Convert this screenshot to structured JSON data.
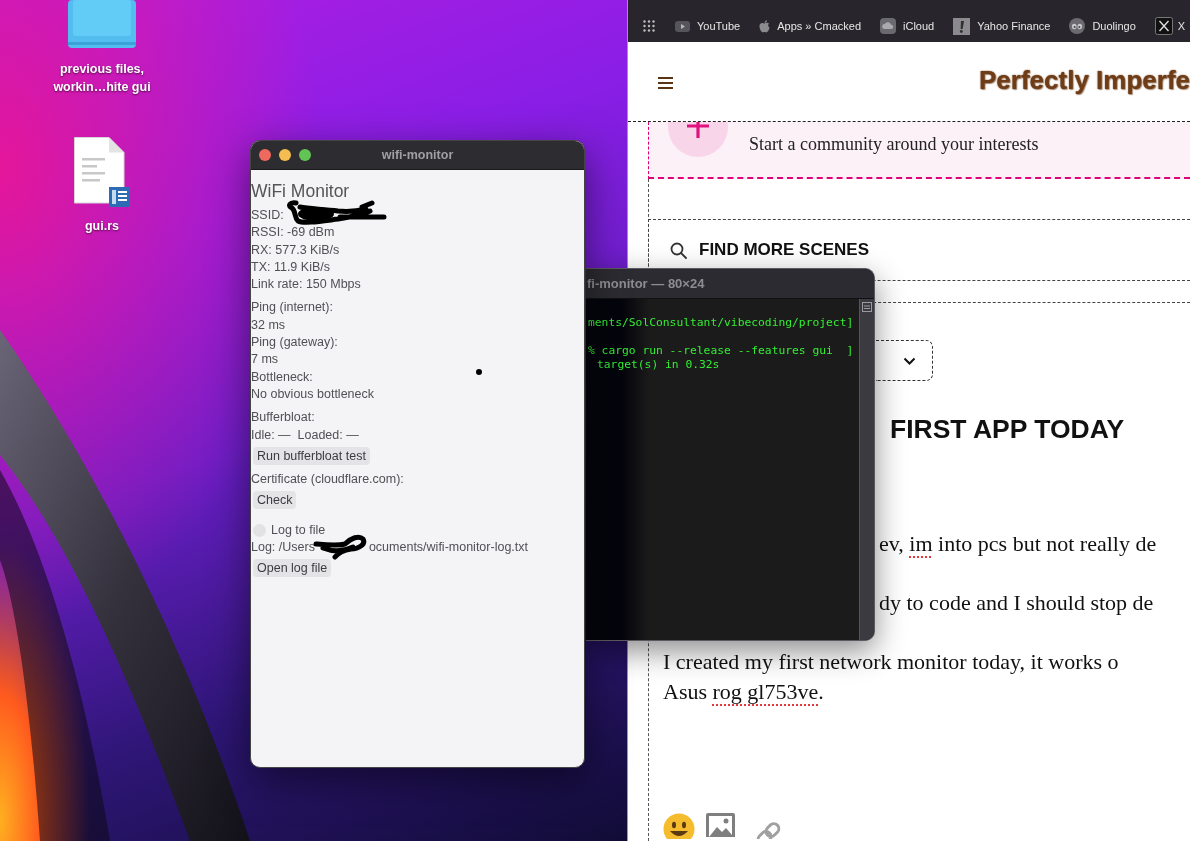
{
  "desktop": {
    "icons": [
      {
        "kind": "folder",
        "label": "previous files, workin…hite gui"
      },
      {
        "kind": "document",
        "label": "gui.rs"
      }
    ]
  },
  "browser": {
    "bookmarks": [
      {
        "label": "YouTube"
      },
      {
        "label": "Apps » Cmacked"
      },
      {
        "label": "iCloud"
      },
      {
        "label": "Yahoo Finance"
      },
      {
        "label": "Duolingo"
      },
      {
        "label": "X"
      }
    ],
    "logo": "Perfectly Imperfe",
    "banner": {
      "text": "Start a community around your interests"
    },
    "find_button": {
      "label": "FIND MORE SCENES"
    },
    "post": {
      "title": "FIRST APP TODAY",
      "paragraphs": [
        {
          "covered": true,
          "lines": [
            [
              {
                "text": "ev, ",
                "misspelled": false
              },
              {
                "text": "im",
                "misspelled": true
              },
              {
                "text": " into pcs but not really de",
                "misspelled": false
              }
            ]
          ]
        },
        {
          "covered": true,
          "lines": [
            [
              {
                "text": "dy to code and I should stop de",
                "misspelled": false
              }
            ]
          ]
        },
        {
          "covered": false,
          "lines": [
            [
              {
                "text": "I created my first network monitor today, it works o",
                "misspelled": false
              }
            ],
            [
              {
                "text": "Asus ",
                "misspelled": false
              },
              {
                "text": "rog gl753ve",
                "misspelled": true
              },
              {
                "text": ".",
                "misspelled": false
              }
            ]
          ]
        }
      ]
    }
  },
  "terminal": {
    "title": "fi-monitor — 80×24",
    "blocks": [
      {
        "lines": [
          {
            "text": "ments/SolConsultant/vibecoding/project]",
            "indent": false
          }
        ]
      },
      {
        "lines": [
          {
            "text": "% cargo run --release --features gui  ]",
            "indent": false
          },
          {
            "text": "target(s) in 0.32s",
            "indent": true
          }
        ]
      }
    ]
  },
  "app_window": {
    "title": "wifi-monitor",
    "heading": "WiFi Monitor",
    "sections": [
      {
        "items": [
          {
            "kind": "text",
            "parts": [
              "SSID:"
            ],
            "redacted": true
          },
          {
            "kind": "text",
            "parts": [
              "RSSI: -69 dBm"
            ],
            "redacted": false
          },
          {
            "kind": "text",
            "parts": [
              "RX: 577.3 KiB/s"
            ],
            "redacted": false
          },
          {
            "kind": "text",
            "parts": [
              "TX: 11.9 KiB/s"
            ],
            "redacted": false
          },
          {
            "kind": "text",
            "parts": [
              "Link rate: 150 Mbps"
            ],
            "redacted": false
          }
        ]
      },
      {
        "items": [
          {
            "kind": "text",
            "parts": [
              "Ping (internet):"
            ],
            "redacted": false
          },
          {
            "kind": "text",
            "parts": [
              "32 ms"
            ],
            "redacted": false
          },
          {
            "kind": "text",
            "parts": [
              "Ping (gateway):"
            ],
            "redacted": false
          },
          {
            "kind": "text",
            "parts": [
              "7 ms"
            ],
            "redacted": false
          },
          {
            "kind": "text",
            "parts": [
              "Bottleneck:"
            ],
            "redacted": false
          },
          {
            "kind": "text",
            "parts": [
              "No obvious bottleneck"
            ],
            "redacted": false
          }
        ]
      },
      {
        "items": [
          {
            "kind": "text",
            "parts": [
              "Bufferbloat:"
            ],
            "redacted": false
          },
          {
            "kind": "text",
            "parts": [
              "Idle: —  Loaded: —"
            ],
            "redacted": false
          },
          {
            "kind": "button",
            "label": "Run bufferbloat test"
          },
          {
            "kind": "text",
            "parts": [
              "Certificate (cloudflare.com):"
            ],
            "redacted": false
          },
          {
            "kind": "button",
            "label": "Check"
          }
        ]
      },
      {
        "items": [
          {
            "kind": "checkbox",
            "label": "Log to file",
            "checked": false
          },
          {
            "kind": "text",
            "parts": [
              "Log: /Users",
              "ocuments/wifi-monitor-log.txt"
            ],
            "redacted": true
          },
          {
            "kind": "button",
            "label": "Open log file"
          }
        ]
      }
    ]
  }
}
